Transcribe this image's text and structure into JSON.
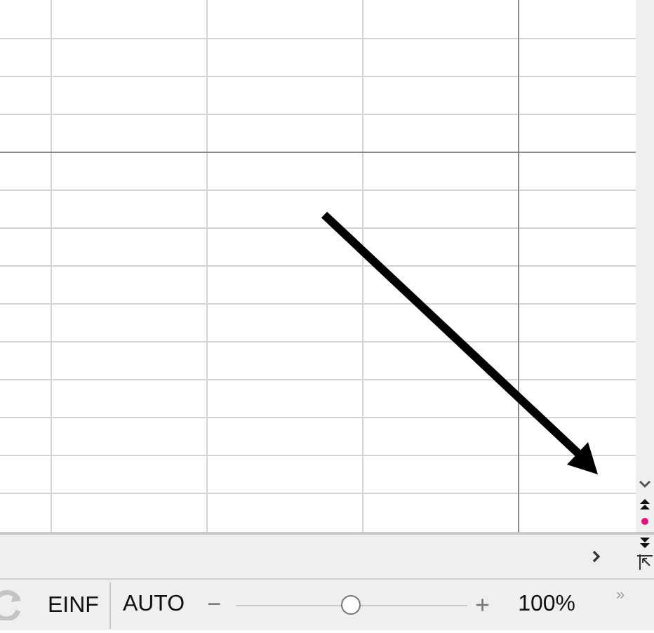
{
  "status_bar": {
    "items": [
      {
        "kind": "text",
        "text": "EINF"
      },
      {
        "kind": "text",
        "text": "AUTO"
      }
    ],
    "zoom": {
      "minus": "−",
      "plus": "+",
      "level": 0.5,
      "value": "100%",
      "more": "»"
    }
  }
}
